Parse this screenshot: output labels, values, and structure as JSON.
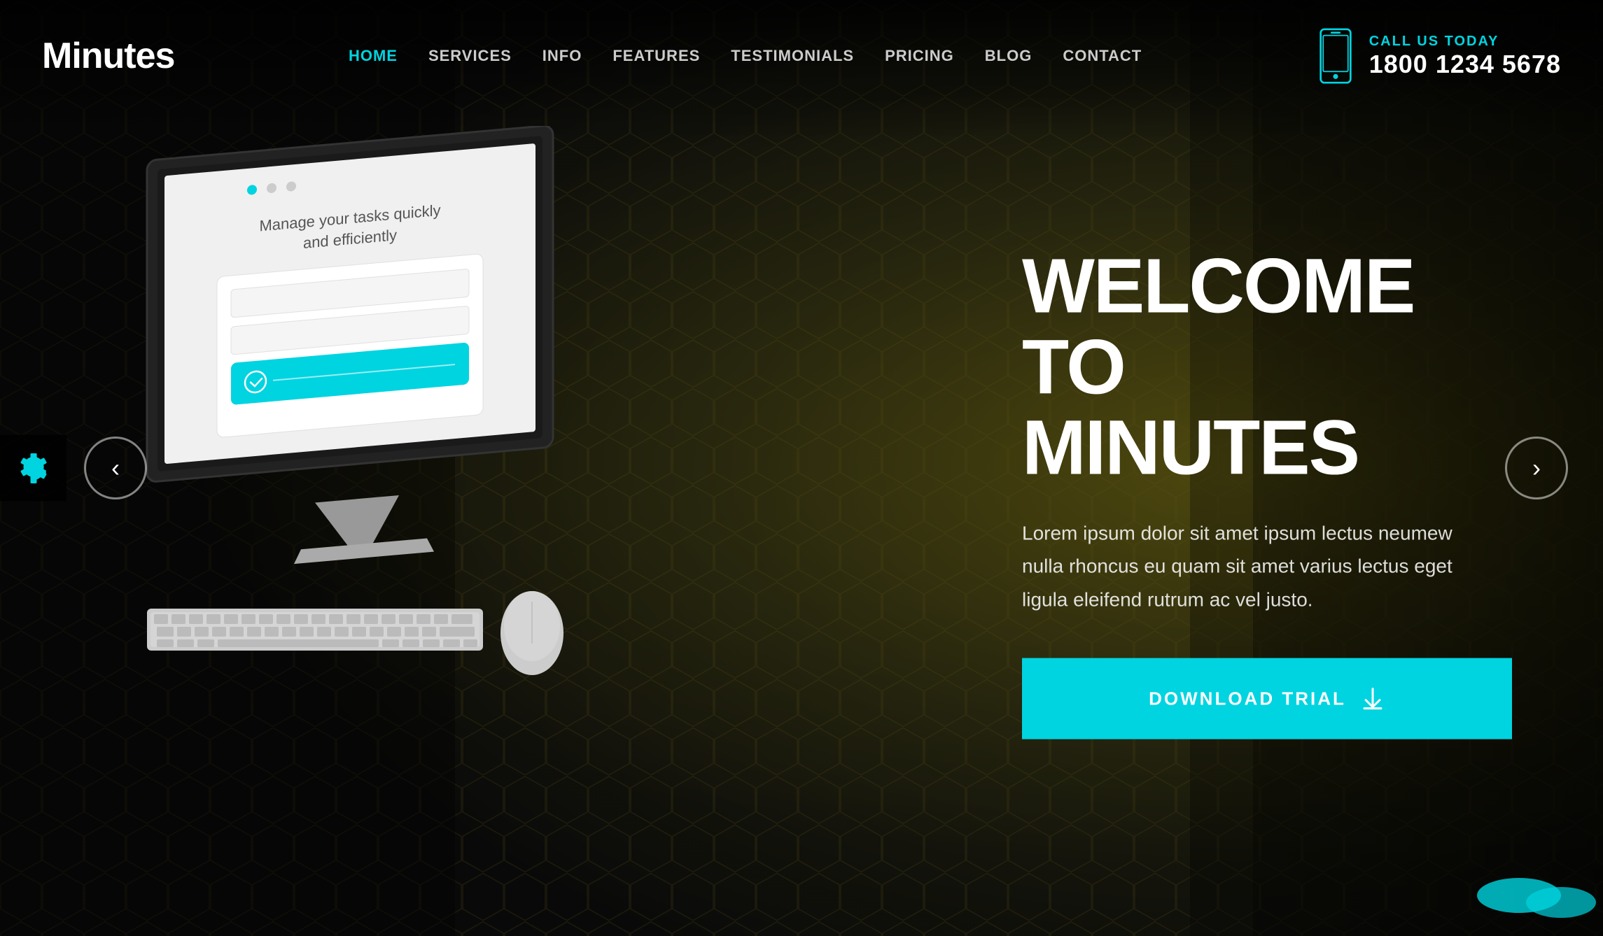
{
  "logo": "Minutes",
  "nav": {
    "items": [
      {
        "label": "HOME",
        "active": true
      },
      {
        "label": "SERVICES",
        "active": false
      },
      {
        "label": "INFO",
        "active": false
      },
      {
        "label": "FEATURES",
        "active": false
      },
      {
        "label": "TESTIMONIALS",
        "active": false
      },
      {
        "label": "PRICING",
        "active": false
      },
      {
        "label": "BLOG",
        "active": false
      },
      {
        "label": "CONTACT",
        "active": false
      }
    ]
  },
  "phone": {
    "call_label": "CALL US TODAY",
    "number": "1800 1234 5678"
  },
  "hero": {
    "title_line1": "WELCOME TO",
    "title_line2": "MINUTES",
    "description": "Lorem ipsum dolor sit amet ipsum lectus neumew nulla rhoncus eu quam sit amet varius lectus eget ligula eleifend\nrutrum ac vel justo.",
    "cta_label": "DOWNLOAD TRIAL"
  },
  "monitor": {
    "screen_text": "Manage your tasks quickly\nand efficiently"
  },
  "slider": {
    "dots": [
      true,
      false,
      false
    ],
    "prev_label": "‹",
    "next_label": "›"
  },
  "colors": {
    "accent": "#00d4e0",
    "bg_dark": "#111111",
    "text_light": "#ffffff"
  }
}
